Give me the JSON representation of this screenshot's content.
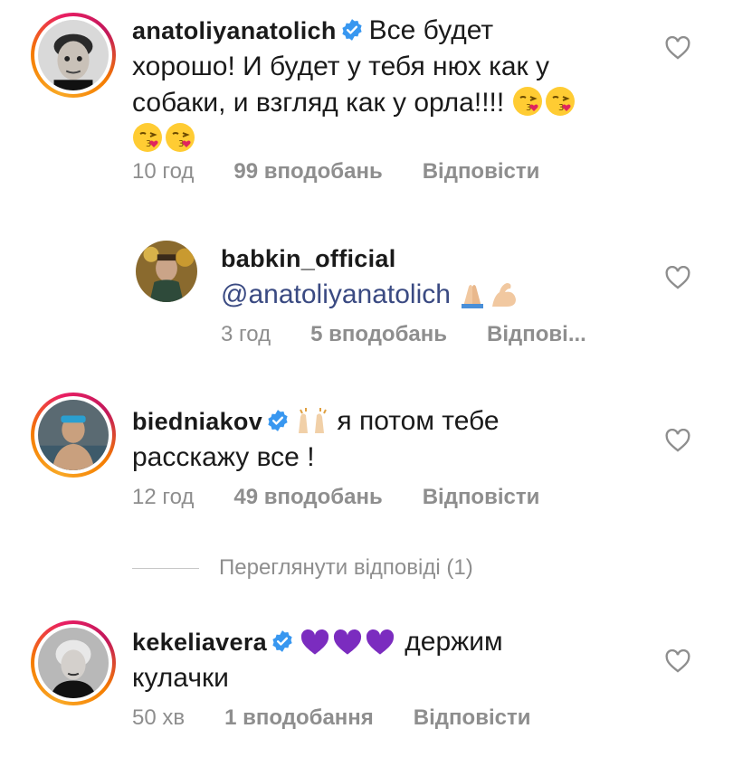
{
  "comments": [
    {
      "username": "anatoliyanatolich",
      "verified": true,
      "text_line1": "Все будет",
      "text_line2": "хорошо! И будет у тебя нюх как у",
      "text_line3": "собаки, и взгляд как у орла!!!!",
      "time": "10 год",
      "likes": "99 вподобань",
      "reply": "Відповісти"
    },
    {
      "username": "babkin_official",
      "verified": false,
      "mention": "@anatoliyanatolich",
      "time": "3 год",
      "likes": "5 вподобань",
      "reply": "Відпові..."
    },
    {
      "username": "biedniakov",
      "verified": true,
      "text_line1": "я потом тебе",
      "text_line2": "расскажу все !",
      "time": "12 год",
      "likes": "49 вподобань",
      "reply": "Відповісти"
    },
    {
      "username": "kekeliavera",
      "verified": true,
      "text_line1": "держим",
      "text_line2": "кулачки",
      "time": "50 хв",
      "likes": "1 вподобання",
      "reply": "Відповісти"
    }
  ],
  "view_replies": "Переглянути відповіді (1)",
  "icons": {
    "like": "heart-outline-icon",
    "verified": "verified-badge-icon"
  },
  "colors": {
    "verified_blue": "#3897f0",
    "meta_gray": "#8e8e8e",
    "mention_blue": "#3a4a82",
    "heart_purple": "#7b2cbf"
  }
}
